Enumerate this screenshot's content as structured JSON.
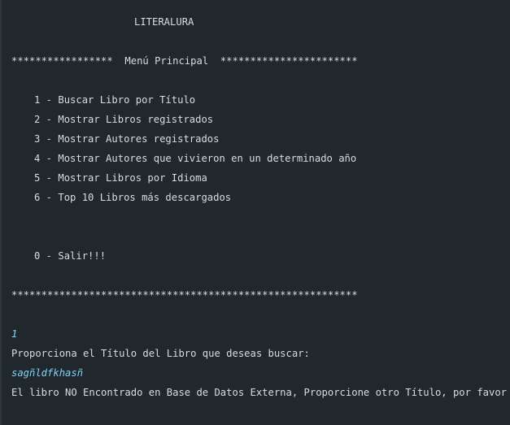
{
  "console": {
    "app_title": "LITERALURA",
    "menu_header": "*****************  Menú Principal  ***********************",
    "menu_items": [
      {
        "number": "1",
        "label": "Buscar Libro por Título"
      },
      {
        "number": "2",
        "label": "Mostrar Libros registrados"
      },
      {
        "number": "3",
        "label": "Mostrar Autores registrados"
      },
      {
        "number": "4",
        "label": "Mostrar Autores que vivieron en un determinado año"
      },
      {
        "number": "5",
        "label": "Mostrar Libros por Idioma"
      },
      {
        "number": "6",
        "label": "Top 10 Libros más descargados"
      }
    ],
    "exit_item": {
      "number": "0",
      "label": "Salir!!!"
    },
    "menu_footer": "**********************************************************",
    "user_choice": "1",
    "prompt_text": "Proporciona el Título del Libro que deseas buscar:",
    "user_query": "sagñldfkhasñ",
    "result_message": "El libro NO Encontrado en Base de Datos Externa, Proporcione otro Título, por favor"
  },
  "colors": {
    "background": "#20282d",
    "output_text": "#d7dde2",
    "user_input_text": "#7fd3f3"
  }
}
